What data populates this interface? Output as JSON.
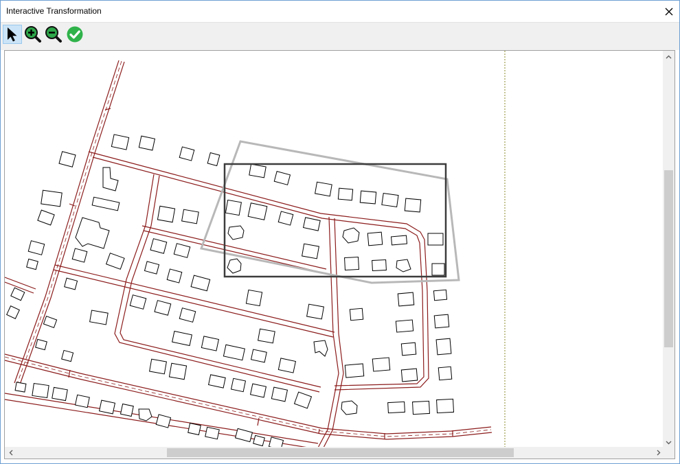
{
  "window": {
    "title": "Interactive Transformation"
  },
  "toolbar": {
    "tools": [
      {
        "name": "select",
        "icon": "arrow-pointer-icon",
        "active": true
      },
      {
        "name": "zoom-in",
        "icon": "zoom-in-icon",
        "active": false
      },
      {
        "name": "zoom-out",
        "icon": "zoom-out-icon",
        "active": false
      },
      {
        "name": "apply",
        "icon": "checkmark-icon",
        "active": false
      }
    ]
  },
  "colors": {
    "road": "#8b1a1a",
    "frame": "#3c3c3c",
    "transformed_frame": "#b8b8b8",
    "apply_green": "#2fb24a",
    "page_border": "#8a8a2a"
  }
}
